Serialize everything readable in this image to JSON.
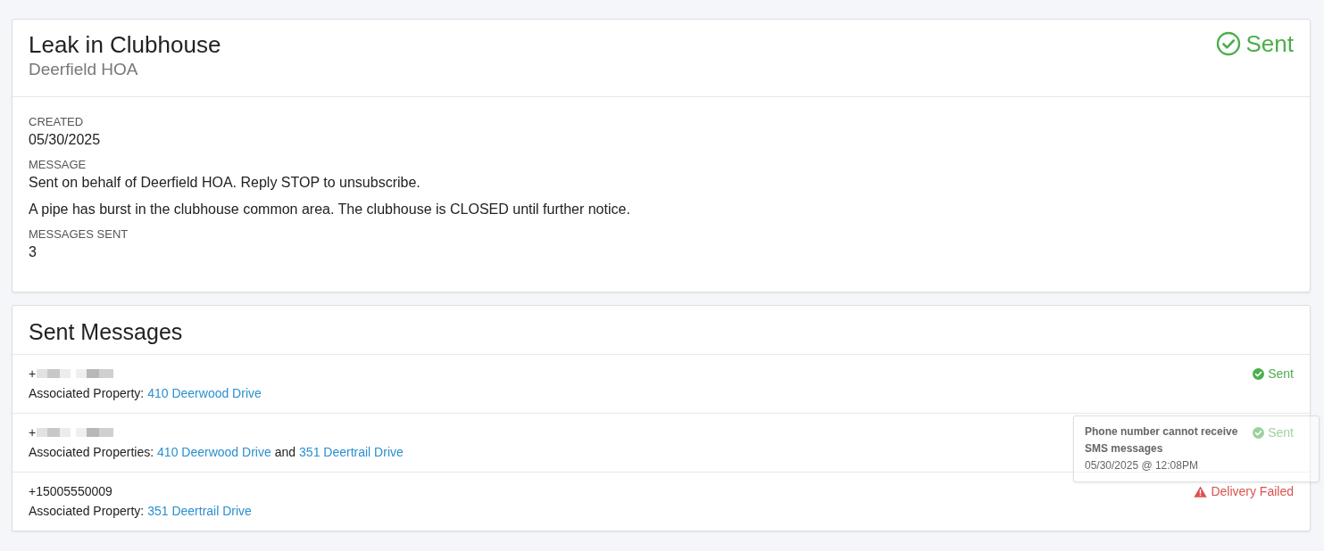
{
  "campaign": {
    "title": "Leak in Clubhouse",
    "subtitle": "Deerfield HOA",
    "status": {
      "kind": "sent",
      "label": "Sent"
    },
    "fields": [
      {
        "label": "CREATED",
        "lines": [
          "05/30/2025"
        ]
      },
      {
        "label": "MESSAGE",
        "lines": [
          "Sent on behalf of Deerfield HOA. Reply STOP to unsubscribe.",
          "A pipe has burst in the clubhouse common area. The clubhouse is CLOSED until further notice."
        ]
      },
      {
        "label": "MESSAGES SENT",
        "lines": [
          "3"
        ]
      }
    ]
  },
  "sent_messages": {
    "title": "Sent Messages",
    "rows": [
      {
        "phone": "+",
        "redacted": true,
        "property_label": "Associated Property:",
        "properties": [
          "410 Deerwood Drive"
        ],
        "joiner": "",
        "status": {
          "kind": "sent",
          "label": "Sent"
        }
      },
      {
        "phone": "+",
        "redacted": true,
        "property_label": "Associated Properties:",
        "properties": [
          "410 Deerwood Drive",
          "351 Deertrail Drive"
        ],
        "joiner": "and",
        "status": {
          "kind": "sent",
          "label": "Sent"
        }
      },
      {
        "phone": "+15005550009",
        "redacted": false,
        "property_label": "Associated Property:",
        "properties": [
          "351 Deertrail Drive"
        ],
        "joiner": "",
        "status": {
          "kind": "failed",
          "label": "Delivery Failed"
        },
        "tooltip": {
          "title": "Phone number cannot receive SMS messages",
          "time": "05/30/2025 @ 12:08PM"
        }
      }
    ]
  }
}
